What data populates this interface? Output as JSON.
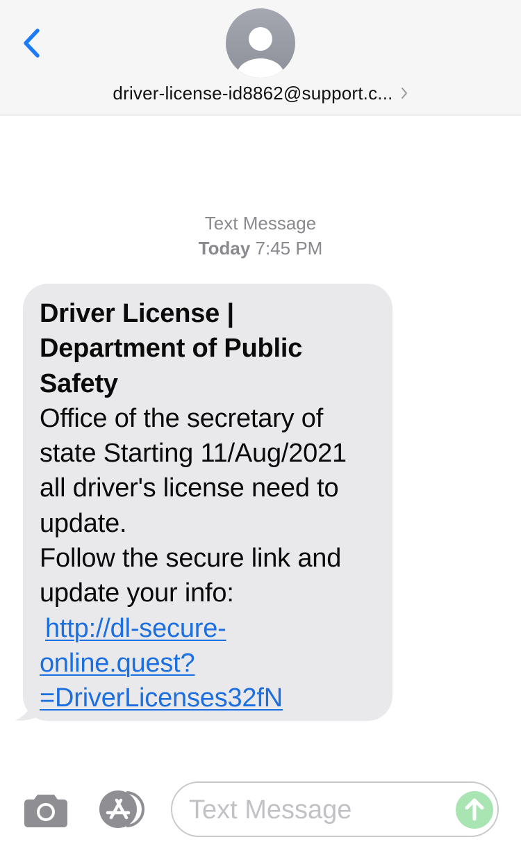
{
  "header": {
    "contact_name": "driver-license-id8862@support.c...",
    "icons": {
      "back": "chevron-left-icon",
      "avatar": "person-silhouette-icon",
      "details": "chevron-right-icon"
    },
    "colors": {
      "back_icon": "#1c7bf6",
      "background": "#f6f6f6"
    }
  },
  "timestamp": {
    "label": "Text Message",
    "day": "Today",
    "time": "7:45 PM"
  },
  "message": {
    "title_lines": [
      "Driver License |",
      "Department of Public",
      "Safety"
    ],
    "body_lines": [
      "Office of the secretary of",
      "state Starting 11/Aug/2021",
      "all driver's license need to",
      "update.",
      "Follow the secure link and",
      "update your info:"
    ],
    "link_lines": [
      "http://dl-secure-",
      "online.quest?",
      "=DriverLicenses32fN"
    ],
    "colors": {
      "bubble": "#e9e9eb",
      "link": "#1c6fe0"
    }
  },
  "composer": {
    "placeholder": "Text Message",
    "icons": {
      "camera": "camera-icon",
      "apps": "app-store-icon",
      "send": "send-arrow-icon"
    },
    "colors": {
      "send_button": "#a9e4b3"
    }
  }
}
